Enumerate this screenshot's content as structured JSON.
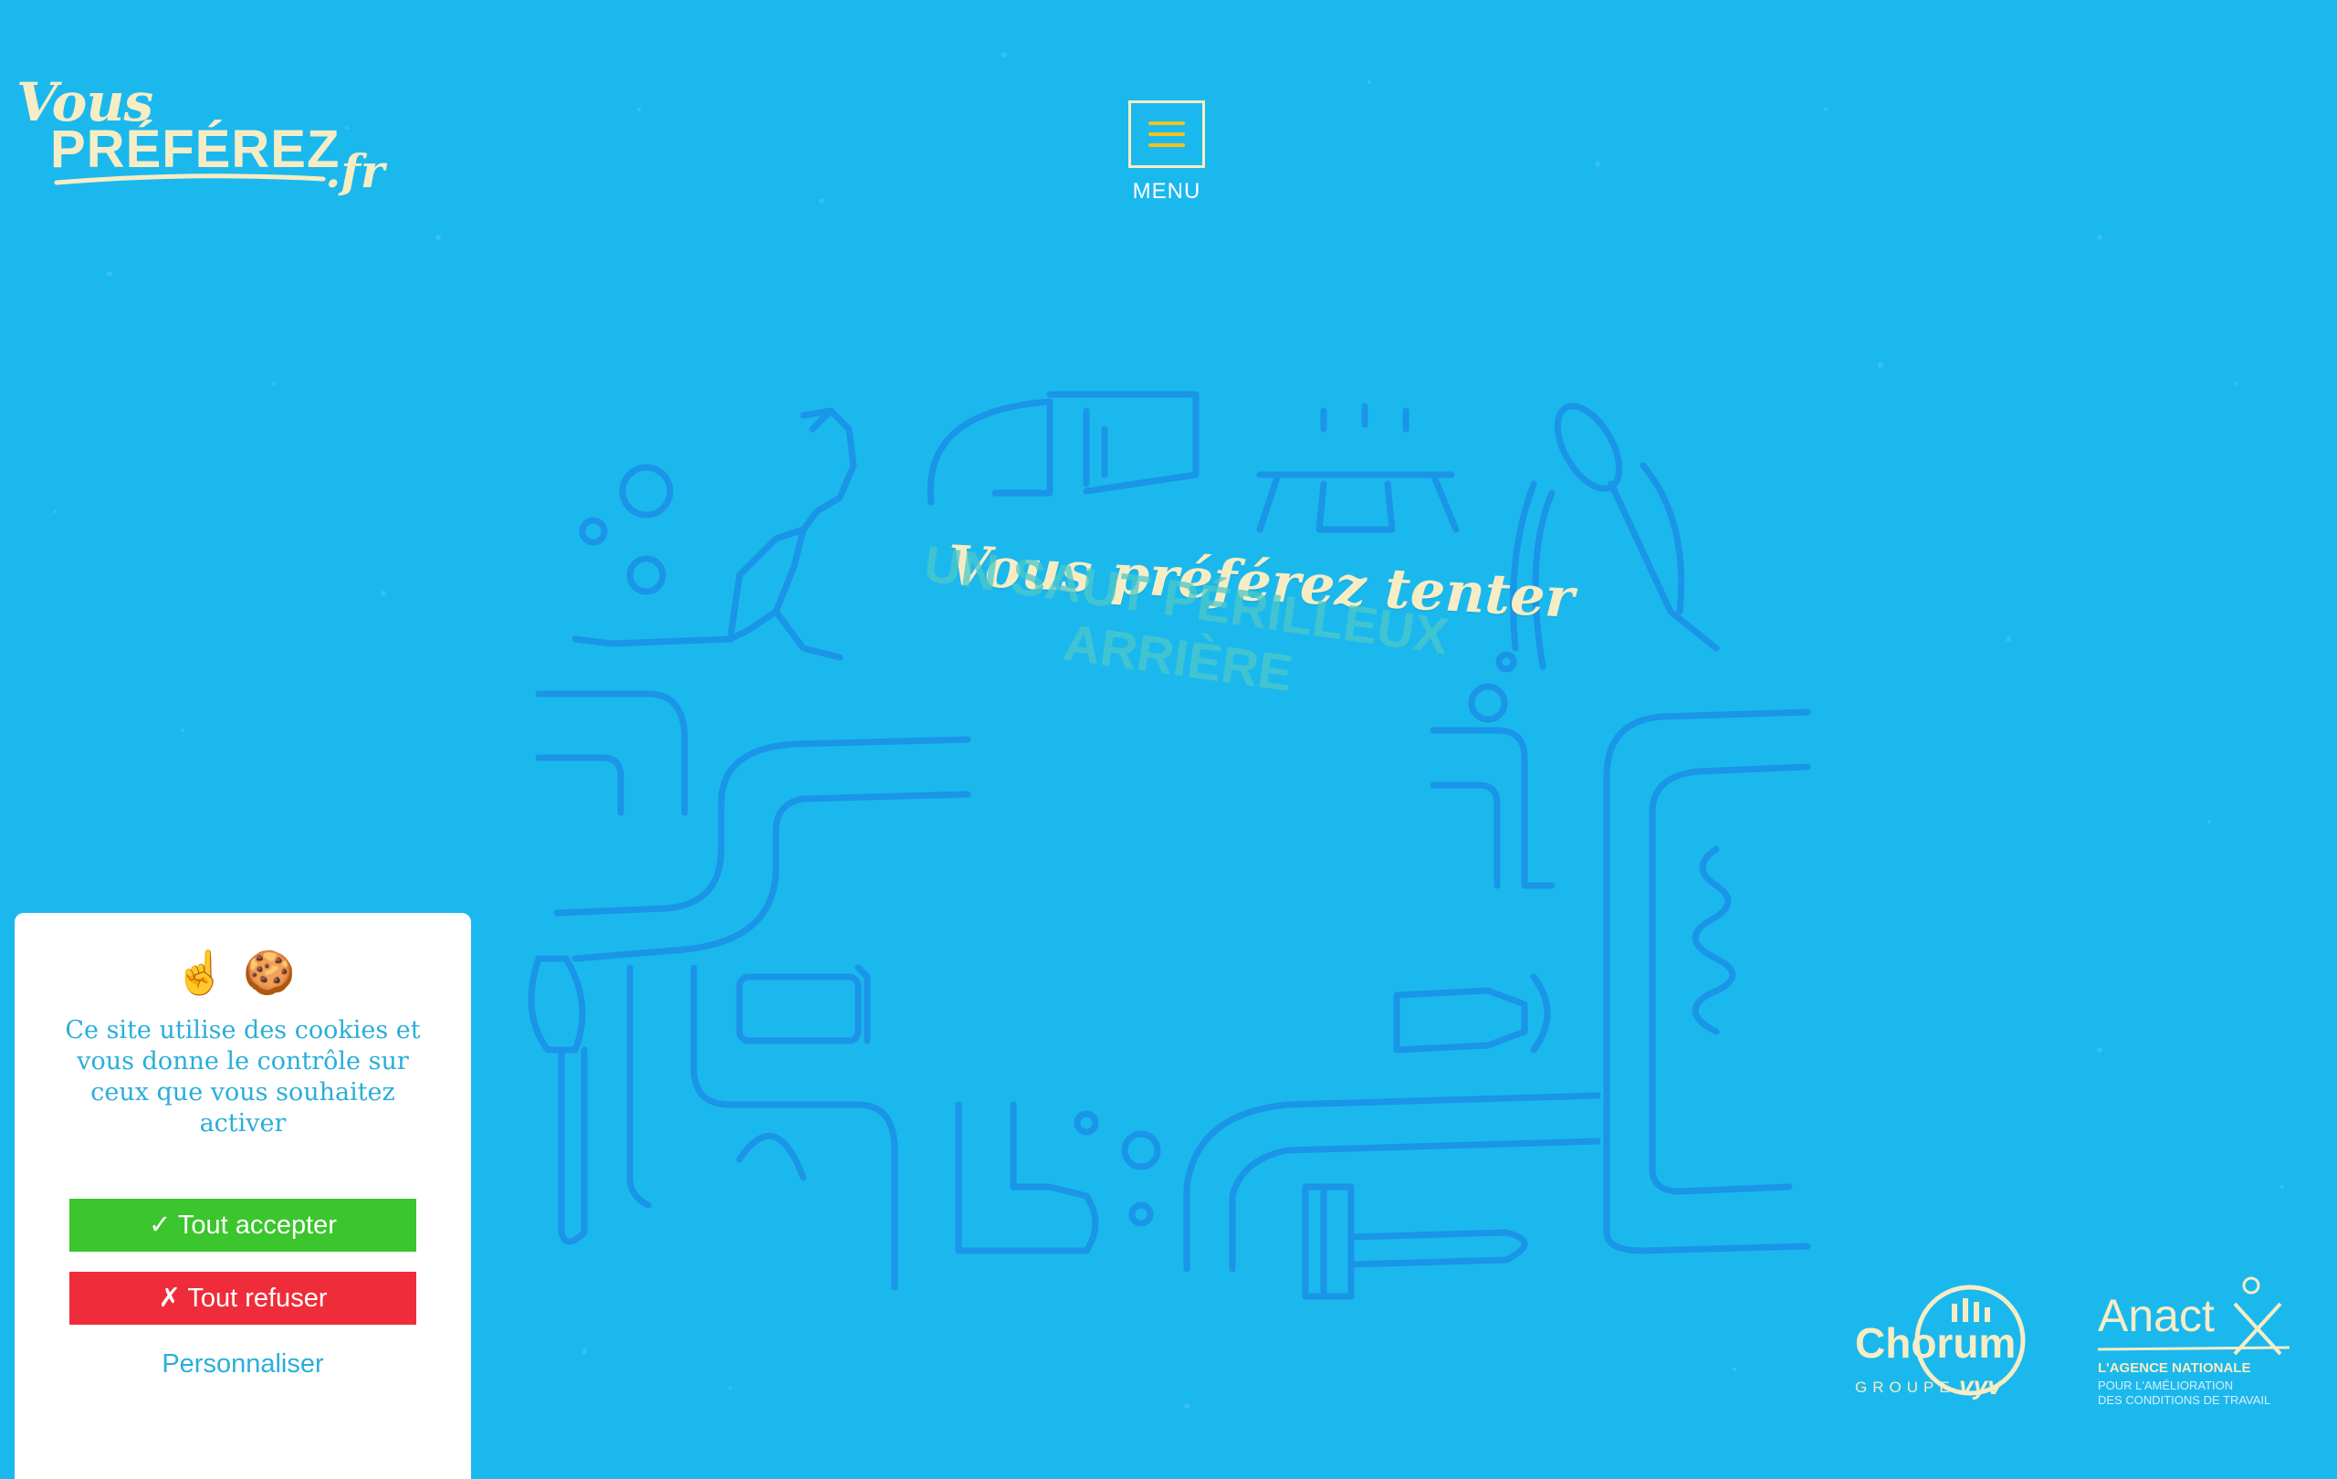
{
  "logo": {
    "line1": "Vous",
    "line2": "PRÉFÉREZ",
    "line3": ".fr"
  },
  "menu": {
    "label": "MENU",
    "icon": "hamburger-icon",
    "icon_color": "#f2c31a"
  },
  "hero": {
    "headline": "Vous préférez tenter",
    "subline": "UN SAUT PÉRILLEUX ARRIÈRE",
    "illustration_items": [
      "kangaroo",
      "trampoline",
      "shower-head",
      "tap",
      "toothbrush",
      "soap",
      "spring",
      "hand",
      "bubbles",
      "razor",
      "pipes"
    ]
  },
  "cookie": {
    "emojis": "☝️🍪",
    "message": "Ce site utilise des cookies et vous donne le contrôle sur ceux que vous souhaitez activer",
    "accept": "✓ Tout accepter",
    "refuse": "✗ Tout refuser",
    "customize": "Personnaliser"
  },
  "partners": {
    "chorum": {
      "name": "Chorum",
      "groupe": "GROUPE",
      "vyv": "vyv"
    },
    "anact": {
      "name": "Anact",
      "line1": "L'AGENCE NATIONALE",
      "line2": "POUR L'AMÉLIORATION",
      "line3": "DES CONDITIONS DE TRAVAIL"
    }
  },
  "colors": {
    "background": "#1bb8ee",
    "cream": "#f6edc4",
    "line_art": "#1a8fe6",
    "accept": "#3ac62c",
    "refuse": "#ef2c39",
    "link": "#2aaed9"
  }
}
